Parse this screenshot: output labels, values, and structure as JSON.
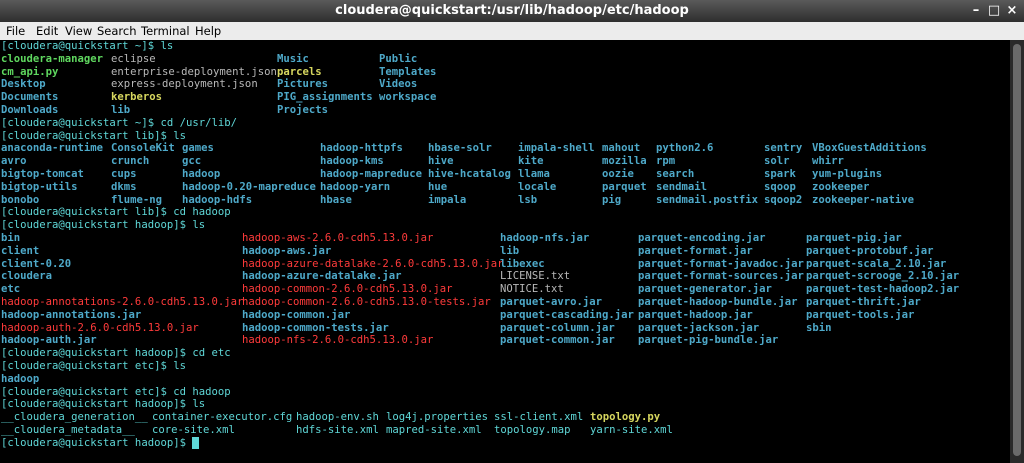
{
  "window": {
    "title": "cloudera@quickstart:/usr/lib/hadoop/etc/hadoop"
  },
  "menu": [
    "File",
    "Edit",
    "View",
    "Search",
    "Terminal",
    "Help"
  ],
  "lines": [
    {
      "kind": "prompt",
      "text": "[cloudera@quickstart ~]$ ls"
    },
    {
      "kind": "grid",
      "cols": [
        [
          0,
          "cloudera-manager",
          "x"
        ],
        [
          110,
          "eclipse",
          "w"
        ],
        [
          276,
          "Music",
          "d"
        ],
        [
          378,
          "Public",
          "d"
        ]
      ]
    },
    {
      "kind": "grid",
      "cols": [
        [
          0,
          "cm_api.py",
          "x"
        ],
        [
          110,
          "enterprise-deployment.json",
          "w"
        ],
        [
          276,
          "parcels",
          "y"
        ],
        [
          378,
          "Templates",
          "d"
        ]
      ]
    },
    {
      "kind": "grid",
      "cols": [
        [
          0,
          "Desktop",
          "d"
        ],
        [
          110,
          "express-deployment.json",
          "w"
        ],
        [
          276,
          "Pictures",
          "d"
        ],
        [
          378,
          "Videos",
          "d"
        ]
      ]
    },
    {
      "kind": "grid",
      "cols": [
        [
          0,
          "Documents",
          "d"
        ],
        [
          110,
          "kerberos",
          "y"
        ],
        [
          276,
          "PIG_assignments",
          "d"
        ],
        [
          378,
          "workspace",
          "d"
        ]
      ]
    },
    {
      "kind": "grid",
      "cols": [
        [
          0,
          "Downloads",
          "d"
        ],
        [
          110,
          "lib",
          "d"
        ],
        [
          276,
          "Projects",
          "d"
        ]
      ]
    },
    {
      "kind": "prompt",
      "text": "[cloudera@quickstart ~]$ cd /usr/lib/"
    },
    {
      "kind": "prompt",
      "text": "[cloudera@quickstart lib]$ ls"
    },
    {
      "kind": "grid",
      "cols": [
        [
          0,
          "anaconda-runtime",
          "d"
        ],
        [
          110,
          "ConsoleKit",
          "d"
        ],
        [
          181,
          "games",
          "d"
        ],
        [
          319,
          "hadoop-httpfs",
          "d"
        ],
        [
          427,
          "hbase-solr",
          "d"
        ],
        [
          517,
          "impala-shell",
          "d"
        ],
        [
          601,
          "mahout",
          "d"
        ],
        [
          655,
          "python2.6",
          "d"
        ],
        [
          763,
          "sentry",
          "d"
        ],
        [
          811,
          "VBoxGuestAdditions",
          "d"
        ]
      ]
    },
    {
      "kind": "grid",
      "cols": [
        [
          0,
          "avro",
          "d"
        ],
        [
          110,
          "crunch",
          "d"
        ],
        [
          181,
          "gcc",
          "d"
        ],
        [
          319,
          "hadoop-kms",
          "d"
        ],
        [
          427,
          "hive",
          "d"
        ],
        [
          517,
          "kite",
          "d"
        ],
        [
          601,
          "mozilla",
          "d"
        ],
        [
          655,
          "rpm",
          "d"
        ],
        [
          763,
          "solr",
          "d"
        ],
        [
          811,
          "whirr",
          "d"
        ]
      ]
    },
    {
      "kind": "grid",
      "cols": [
        [
          0,
          "bigtop-tomcat",
          "d"
        ],
        [
          110,
          "cups",
          "d"
        ],
        [
          181,
          "hadoop",
          "d"
        ],
        [
          319,
          "hadoop-mapreduce",
          "d"
        ],
        [
          427,
          "hive-hcatalog",
          "d"
        ],
        [
          517,
          "llama",
          "d"
        ],
        [
          601,
          "oozie",
          "d"
        ],
        [
          655,
          "search",
          "d"
        ],
        [
          763,
          "spark",
          "d"
        ],
        [
          811,
          "yum-plugins",
          "d"
        ]
      ]
    },
    {
      "kind": "grid",
      "cols": [
        [
          0,
          "bigtop-utils",
          "d"
        ],
        [
          110,
          "dkms",
          "d"
        ],
        [
          181,
          "hadoop-0.20-mapreduce",
          "d"
        ],
        [
          319,
          "hadoop-yarn",
          "d"
        ],
        [
          427,
          "hue",
          "d"
        ],
        [
          517,
          "locale",
          "d"
        ],
        [
          601,
          "parquet",
          "d"
        ],
        [
          655,
          "sendmail",
          "d"
        ],
        [
          763,
          "sqoop",
          "d"
        ],
        [
          811,
          "zookeeper",
          "d"
        ]
      ]
    },
    {
      "kind": "grid",
      "cols": [
        [
          0,
          "bonobo",
          "d"
        ],
        [
          110,
          "flume-ng",
          "d"
        ],
        [
          181,
          "hadoop-hdfs",
          "d"
        ],
        [
          319,
          "hbase",
          "d"
        ],
        [
          427,
          "impala",
          "d"
        ],
        [
          517,
          "lsb",
          "d"
        ],
        [
          601,
          "pig",
          "d"
        ],
        [
          655,
          "sendmail.postfix",
          "d"
        ],
        [
          763,
          "sqoop2",
          "d"
        ],
        [
          811,
          "zookeeper-native",
          "d"
        ]
      ]
    },
    {
      "kind": "prompt",
      "text": "[cloudera@quickstart lib]$ cd hadoop"
    },
    {
      "kind": "prompt",
      "text": "[cloudera@quickstart hadoop]$ ls"
    },
    {
      "kind": "grid",
      "cols": [
        [
          0,
          "bin",
          "d"
        ],
        [
          241,
          "hadoop-aws-2.6.0-cdh5.13.0.jar",
          "r"
        ],
        [
          499,
          "hadoop-nfs.jar",
          "d"
        ],
        [
          637,
          "parquet-encoding.jar",
          "d"
        ],
        [
          805,
          "parquet-pig.jar",
          "d"
        ]
      ]
    },
    {
      "kind": "grid",
      "cols": [
        [
          0,
          "client",
          "d"
        ],
        [
          241,
          "hadoop-aws.jar",
          "d"
        ],
        [
          499,
          "lib",
          "d"
        ],
        [
          637,
          "parquet-format.jar",
          "d"
        ],
        [
          805,
          "parquet-protobuf.jar",
          "d"
        ]
      ]
    },
    {
      "kind": "grid",
      "cols": [
        [
          0,
          "client-0.20",
          "d"
        ],
        [
          241,
          "hadoop-azure-datalake-2.6.0-cdh5.13.0.jar",
          "r"
        ],
        [
          499,
          "libexec",
          "d"
        ],
        [
          637,
          "parquet-format-javadoc.jar",
          "d"
        ],
        [
          805,
          "parquet-scala_2.10.jar",
          "d"
        ]
      ]
    },
    {
      "kind": "grid",
      "cols": [
        [
          0,
          "cloudera",
          "d"
        ],
        [
          241,
          "hadoop-azure-datalake.jar",
          "d"
        ],
        [
          499,
          "LICENSE.txt",
          "w"
        ],
        [
          637,
          "parquet-format-sources.jar",
          "d"
        ],
        [
          805,
          "parquet-scrooge_2.10.jar",
          "d"
        ]
      ]
    },
    {
      "kind": "grid",
      "cols": [
        [
          0,
          "etc",
          "d"
        ],
        [
          241,
          "hadoop-common-2.6.0-cdh5.13.0.jar",
          "r"
        ],
        [
          499,
          "NOTICE.txt",
          "w"
        ],
        [
          637,
          "parquet-generator.jar",
          "d"
        ],
        [
          805,
          "parquet-test-hadoop2.jar",
          "d"
        ]
      ]
    },
    {
      "kind": "grid",
      "cols": [
        [
          0,
          "hadoop-annotations-2.6.0-cdh5.13.0.jar",
          "r"
        ],
        [
          241,
          "hadoop-common-2.6.0-cdh5.13.0-tests.jar",
          "r"
        ],
        [
          499,
          "parquet-avro.jar",
          "d"
        ],
        [
          637,
          "parquet-hadoop-bundle.jar",
          "d"
        ],
        [
          805,
          "parquet-thrift.jar",
          "d"
        ]
      ]
    },
    {
      "kind": "grid",
      "cols": [
        [
          0,
          "hadoop-annotations.jar",
          "d"
        ],
        [
          241,
          "hadoop-common.jar",
          "d"
        ],
        [
          499,
          "parquet-cascading.jar",
          "d"
        ],
        [
          637,
          "parquet-hadoop.jar",
          "d"
        ],
        [
          805,
          "parquet-tools.jar",
          "d"
        ]
      ]
    },
    {
      "kind": "grid",
      "cols": [
        [
          0,
          "hadoop-auth-2.6.0-cdh5.13.0.jar",
          "r"
        ],
        [
          241,
          "hadoop-common-tests.jar",
          "d"
        ],
        [
          499,
          "parquet-column.jar",
          "d"
        ],
        [
          637,
          "parquet-jackson.jar",
          "d"
        ],
        [
          805,
          "sbin",
          "d"
        ]
      ]
    },
    {
      "kind": "grid",
      "cols": [
        [
          0,
          "hadoop-auth.jar",
          "d"
        ],
        [
          241,
          "hadoop-nfs-2.6.0-cdh5.13.0.jar",
          "r"
        ],
        [
          499,
          "parquet-common.jar",
          "d"
        ],
        [
          637,
          "parquet-pig-bundle.jar",
          "d"
        ]
      ]
    },
    {
      "kind": "prompt",
      "text": "[cloudera@quickstart hadoop]$ cd etc"
    },
    {
      "kind": "prompt",
      "text": "[cloudera@quickstart etc]$ ls"
    },
    {
      "kind": "grid",
      "cols": [
        [
          0,
          "hadoop",
          "d"
        ]
      ]
    },
    {
      "kind": "prompt",
      "text": "[cloudera@quickstart etc]$ cd hadoop"
    },
    {
      "kind": "prompt",
      "text": "[cloudera@quickstart hadoop]$ ls"
    },
    {
      "kind": "grid",
      "cols": [
        [
          0,
          "__cloudera_generation__",
          "f"
        ],
        [
          151,
          "container-executor.cfg",
          "f"
        ],
        [
          295,
          "hadoop-env.sh",
          "f"
        ],
        [
          385,
          "log4j.properties",
          "f"
        ],
        [
          493,
          "ssl-client.xml",
          "f"
        ],
        [
          589,
          "topology.py",
          "y"
        ]
      ]
    },
    {
      "kind": "grid",
      "cols": [
        [
          0,
          "__cloudera_metadata__",
          "f"
        ],
        [
          151,
          "core-site.xml",
          "f"
        ],
        [
          295,
          "hdfs-site.xml",
          "f"
        ],
        [
          385,
          "mapred-site.xml",
          "f"
        ],
        [
          493,
          "topology.map",
          "f"
        ],
        [
          589,
          "yarn-site.xml",
          "f"
        ]
      ]
    },
    {
      "kind": "prompt",
      "text": "[cloudera@quickstart hadoop]$ ",
      "cursor": true
    }
  ]
}
